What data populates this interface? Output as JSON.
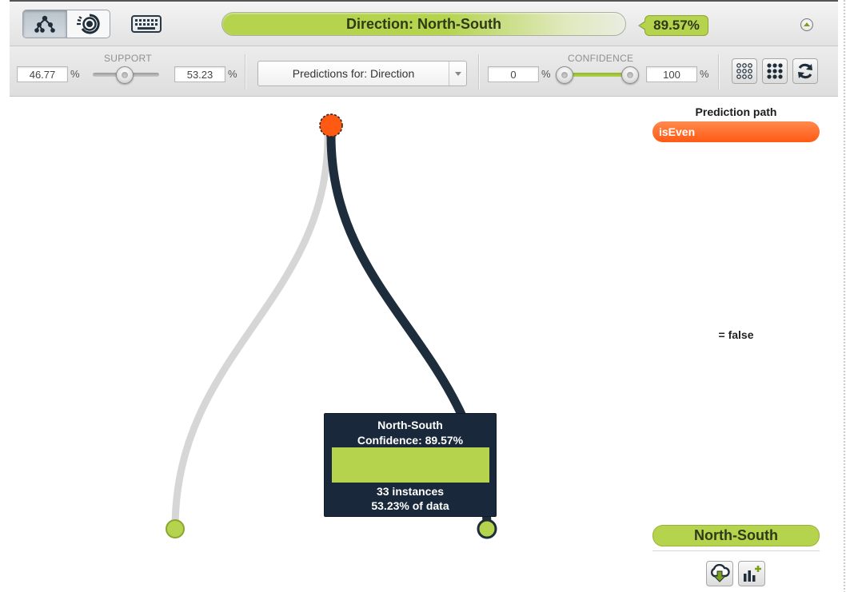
{
  "header": {
    "direction_label": "Direction: North-South",
    "confidence_pct": "89.57%",
    "colors": {
      "accent_green": "#b5d34d",
      "orange": "#ff5a14",
      "navy": "#1e2d3b"
    }
  },
  "icons": {
    "tree_mode": "tree-icon",
    "sunburst_mode": "sunburst-icon",
    "keyboard": "keyboard-icon",
    "collapse": "collapse-up-icon",
    "compact_view": "dots-grid-outline-icon",
    "expanded_view": "dots-grid-filled-icon",
    "reset": "refresh-icon",
    "download": "cloud-download-icon",
    "add_chart": "bar-chart-plus-icon"
  },
  "support": {
    "label": "SUPPORT",
    "min_value": "46.77",
    "max_value": "53.23",
    "percent_sign": "%"
  },
  "predictions_select": {
    "selected": "Predictions for: Direction"
  },
  "confidence": {
    "label": "CONFIDENCE",
    "min_value": "0",
    "max_value": "100",
    "percent_sign": "%"
  },
  "tooltip": {
    "class_name": "North-South",
    "confidence_text": "Confidence: 89.57%",
    "confidence_value": 89.57,
    "instances_text": "33 instances",
    "data_text": "53.23% of data"
  },
  "prediction_path": {
    "title": "Prediction path",
    "field": "isEven",
    "condition": "= false",
    "result": "North-South"
  }
}
